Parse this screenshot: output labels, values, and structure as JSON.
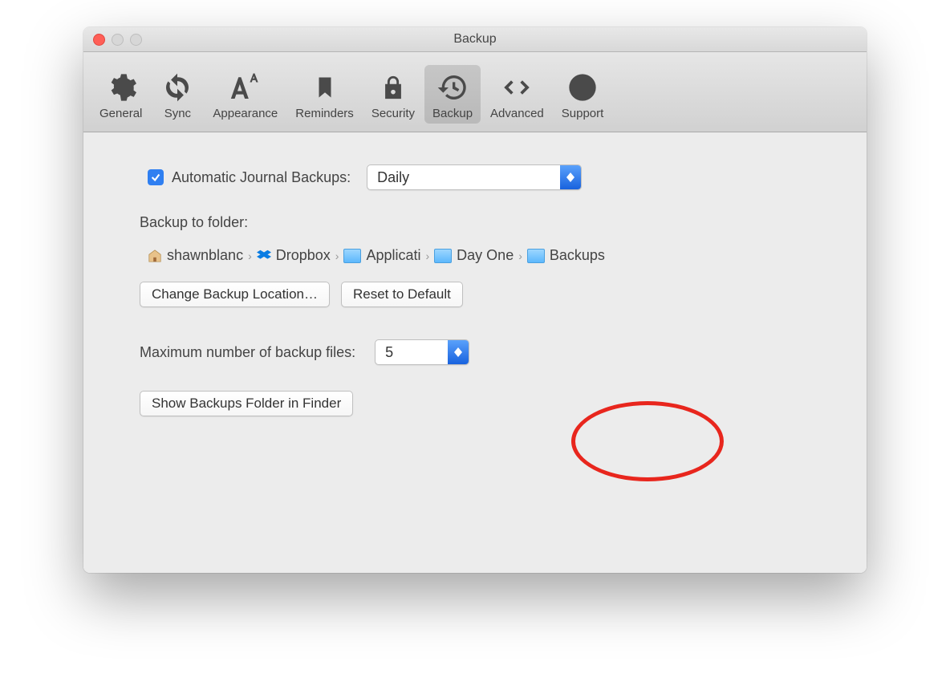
{
  "window": {
    "title": "Backup"
  },
  "toolbar": {
    "items": [
      {
        "label": "General"
      },
      {
        "label": "Sync"
      },
      {
        "label": "Appearance"
      },
      {
        "label": "Reminders"
      },
      {
        "label": "Security"
      },
      {
        "label": "Backup"
      },
      {
        "label": "Advanced"
      },
      {
        "label": "Support"
      }
    ],
    "activeIndex": 5
  },
  "content": {
    "autoBackup": {
      "label": "Automatic Journal Backups:",
      "checked": true,
      "value": "Daily"
    },
    "folderSection": {
      "title": "Backup to folder:",
      "breadcrumb": [
        {
          "label": "shawnblanc",
          "type": "home"
        },
        {
          "label": "Dropbox",
          "type": "dropbox"
        },
        {
          "label": "Applicati",
          "type": "folder",
          "truncated": true
        },
        {
          "label": "Day One",
          "type": "folder"
        },
        {
          "label": "Backups",
          "type": "folder"
        }
      ],
      "changeLocation": "Change Backup Location…",
      "resetDefault": "Reset to Default"
    },
    "maxFiles": {
      "label": "Maximum number of backup files:",
      "value": "5"
    },
    "showInFinder": "Show Backups Folder in Finder"
  }
}
